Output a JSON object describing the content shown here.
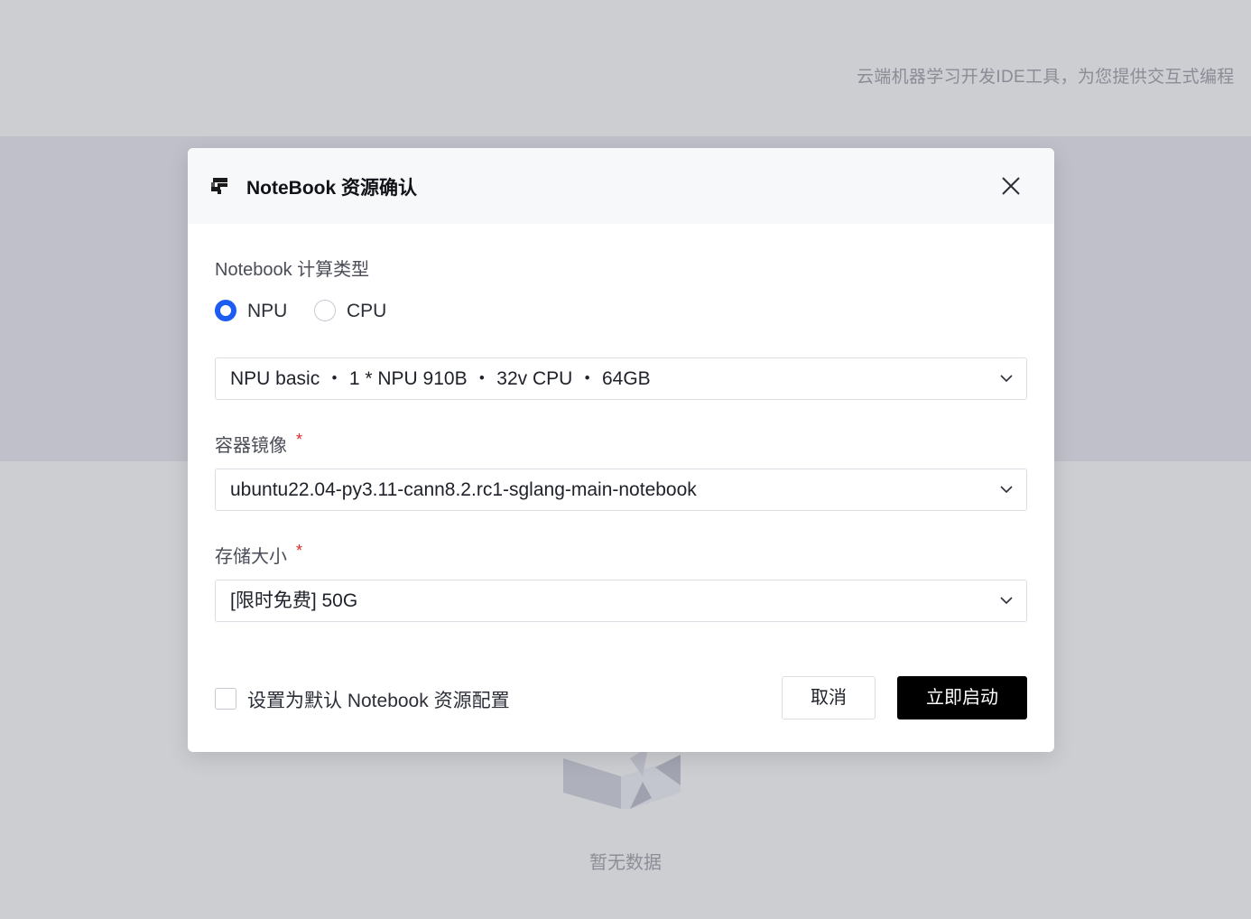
{
  "background": {
    "subtitle": "云端机器学习开发IDE工具，为您提供交互式编程",
    "empty_text": "暂无数据"
  },
  "modal": {
    "title": "NoteBook 资源确认",
    "compute_type": {
      "label": "Notebook 计算类型",
      "options": [
        {
          "label": "NPU",
          "checked": true
        },
        {
          "label": "CPU",
          "checked": false
        }
      ]
    },
    "spec_select": {
      "value": "NPU basic ・ 1 * NPU 910B ・ 32v CPU ・ 64GB"
    },
    "image": {
      "label": "容器镜像",
      "required": "*",
      "value": "ubuntu22.04-py3.11-cann8.2.rc1-sglang-main-notebook"
    },
    "storage": {
      "label": "存储大小",
      "required": "*",
      "value": "[限时免费] 50G"
    },
    "footer": {
      "default_checkbox_label": "设置为默认 Notebook 资源配置",
      "cancel_label": "取消",
      "start_label": "立即启动"
    }
  },
  "colors": {
    "accent": "#1c5cf0",
    "primary_button": "#000000",
    "required": "#e0262b"
  }
}
